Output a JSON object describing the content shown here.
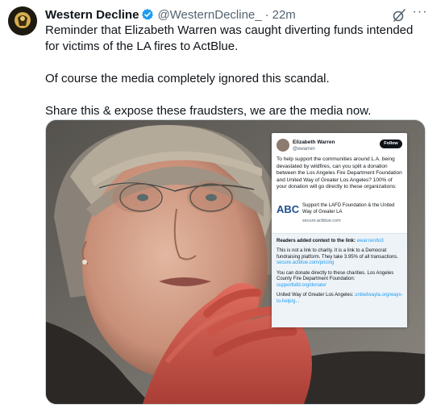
{
  "tweet": {
    "author_name": "Western Decline",
    "handle": "@WesternDecline_",
    "separator": "·",
    "time": "22m",
    "more": "···",
    "paragraphs": [
      "Reminder that Elizabeth Warren was caught diverting funds intended for victims of the LA fires to ActBlue.",
      "Of course the media completely ignored this scandal.",
      "Share this & expose these fraudsters, we are the media now."
    ]
  },
  "embedded": {
    "name": "Elizabeth Warren",
    "handle": "@ewarren",
    "follow": "Follow",
    "body": "To help support the communities around L.A. being devastated by wildfires, can you split a donation between the Los Angeles Fire Department Foundation and United Way of Greater Los Angeles? 100% of your donation will go directly to these organizations:",
    "link_logo": "ABC",
    "link_title": "Support the LAFD Foundation & the United Way of Greater LA",
    "link_domain": "secure.actblue.com",
    "note_head": "Readers added context to the link:",
    "note_head_link": "ewar.ren/to3",
    "note_p1": "This is not a link to charity. It is a link to a Democrat fundraising platform. They take 3.95% of all transactions.",
    "note_p1_link": "secure.actblue.com/pricing",
    "note_p2": "You can donate directly to these charities. Los Angeles County Fire Department Foundation:",
    "note_p2_link": "supportlafd.org/donate/",
    "note_p3": "United Way of Greater Los Angeles:",
    "note_p3_link": "unitedwayla.org/ways-to-help/g..."
  },
  "colors": {
    "verified": "#1d9bf0",
    "link": "#1d9bf0",
    "muted": "#536471"
  },
  "icons": [
    "verified-badge-icon",
    "grok-icon",
    "more-icon"
  ]
}
